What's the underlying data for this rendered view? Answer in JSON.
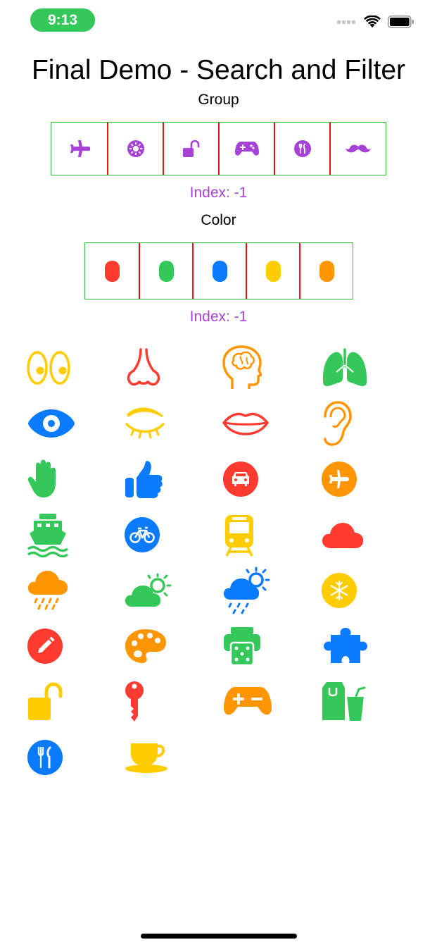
{
  "status_bar": {
    "time": "9:13"
  },
  "title": "Final Demo - Search and Filter",
  "group": {
    "label": "Group",
    "index_text": "Index: -1",
    "icons": [
      "airplane-icon",
      "sun-icon",
      "lock-open-icon",
      "gamecontroller-icon",
      "fork-knife-icon",
      "mustache-icon"
    ]
  },
  "color": {
    "label": "Color",
    "index_text": "Index: -1",
    "swatches": [
      "#ff3b30",
      "#34c759",
      "#0a7aff",
      "#ffcc00",
      "#ff9500"
    ]
  },
  "colors": {
    "red": "#ff3b30",
    "green": "#34c759",
    "blue": "#0a7aff",
    "yellow": "#ffcc00",
    "orange": "#ff9500",
    "purple": "#a742d6"
  },
  "icon_grid": [
    {
      "name": "eyes-icon",
      "color": "#ffcc00"
    },
    {
      "name": "nose-icon",
      "color": "#ff3b30"
    },
    {
      "name": "brain-head-icon",
      "color": "#ff9500"
    },
    {
      "name": "lungs-icon",
      "color": "#34c759"
    },
    {
      "name": "eye-icon",
      "color": "#0a7aff"
    },
    {
      "name": "eye-closed-icon",
      "color": "#ffcc00"
    },
    {
      "name": "mouth-icon",
      "color": "#ff3b30"
    },
    {
      "name": "ear-icon",
      "color": "#ff9500"
    },
    {
      "name": "hand-icon",
      "color": "#34c759"
    },
    {
      "name": "thumbs-up-icon",
      "color": "#0a7aff"
    },
    {
      "name": "car-circle-icon",
      "color": "#ff3b30"
    },
    {
      "name": "airplane-circle-icon",
      "color": "#ff9500"
    },
    {
      "name": "ferry-icon",
      "color": "#34c759"
    },
    {
      "name": "bicycle-circle-icon",
      "color": "#0a7aff"
    },
    {
      "name": "tram-icon",
      "color": "#ffcc00"
    },
    {
      "name": "cloud-icon",
      "color": "#ff3b30"
    },
    {
      "name": "cloud-rain-icon",
      "color": "#ff9500"
    },
    {
      "name": "cloud-sun-icon",
      "color": "#34c759"
    },
    {
      "name": "cloud-sun-rain-icon",
      "color": "#0a7aff"
    },
    {
      "name": "snowflake-circle-icon",
      "color": "#ffcc00"
    },
    {
      "name": "pencil-circle-icon",
      "color": "#ff3b30"
    },
    {
      "name": "paintpalette-icon",
      "color": "#ff9500"
    },
    {
      "name": "dice-printer-icon",
      "color": "#34c759"
    },
    {
      "name": "puzzle-piece-icon",
      "color": "#0a7aff"
    },
    {
      "name": "lock-open-icon",
      "color": "#ffcc00"
    },
    {
      "name": "key-icon",
      "color": "#ff3b30"
    },
    {
      "name": "gamecontroller-icon",
      "color": "#ff9500"
    },
    {
      "name": "takeoutbag-cup-icon",
      "color": "#34c759"
    },
    {
      "name": "fork-knife-circle-icon",
      "color": "#0a7aff"
    },
    {
      "name": "cup-saucer-icon",
      "color": "#ffcc00"
    }
  ]
}
